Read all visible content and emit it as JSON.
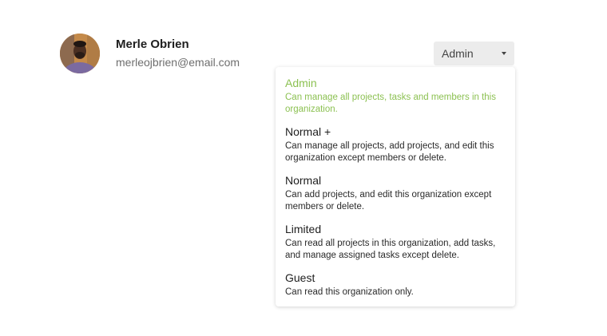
{
  "user": {
    "name": "Merle Obrien",
    "email": "merleojbrien@email.com",
    "avatar": "person-avatar"
  },
  "role_select": {
    "value": "Admin",
    "icon": "caret-down-icon"
  },
  "colors": {
    "selected": "#8cc152",
    "select_bg": "#ececec"
  },
  "options": [
    {
      "title": "Admin",
      "desc": "Can manage all projects, tasks and members in this organization.",
      "selected": true
    },
    {
      "title": "Normal +",
      "desc": "Can manage all projects, add projects, and edit this organization except members or delete."
    },
    {
      "title": "Normal",
      "desc": "Can add projects, and edit this organization except members or delete."
    },
    {
      "title": "Limited",
      "desc": "Can read all projects in this organization, add tasks, and manage assigned tasks except delete."
    },
    {
      "title": "Guest",
      "desc": "Can read this organization only."
    }
  ]
}
